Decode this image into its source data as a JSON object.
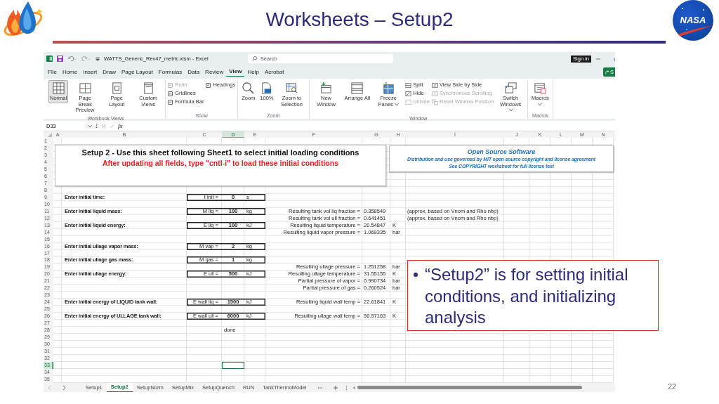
{
  "slide": {
    "title": "Worksheets – Setup2",
    "logo_text": "NASA",
    "page_number": "22",
    "callout": {
      "text": "“Setup2” is for setting initial conditions, and initializing analysis"
    }
  },
  "excel": {
    "title_bar": {
      "file_title": "WATTS_Generic_Rev47_metric.xlsm  -  Excel",
      "search": {
        "placeholder": "Search"
      },
      "sign_in": "Sign in",
      "share": "S"
    },
    "menu": [
      {
        "label": "File",
        "selected": false
      },
      {
        "label": "Home",
        "selected": false
      },
      {
        "label": "Insert",
        "selected": false
      },
      {
        "label": "Draw",
        "selected": false
      },
      {
        "label": "Page Layout",
        "selected": false
      },
      {
        "label": "Formulas",
        "selected": false
      },
      {
        "label": "Data",
        "selected": false
      },
      {
        "label": "Review",
        "selected": false
      },
      {
        "label": "View",
        "selected": true
      },
      {
        "label": "Help",
        "selected": false
      },
      {
        "label": "Acrobat",
        "selected": false
      }
    ],
    "ribbon": [
      {
        "label": "Workbook Views",
        "columns": [
          [
            {
              "kind": "large",
              "label": "Normal",
              "selected": true
            }
          ],
          [
            {
              "kind": "large",
              "label": "Page Break Preview",
              "selected": false
            }
          ],
          [
            {
              "kind": "large",
              "label": "Page Layout",
              "selected": false
            }
          ],
          [
            {
              "kind": "large",
              "label": "Custom Views",
              "selected": false
            }
          ]
        ]
      },
      {
        "label": "Show",
        "columns": [
          [
            {
              "kind": "check",
              "label": "Ruler",
              "checked": true,
              "disabled": true
            },
            {
              "kind": "check",
              "label": "Gridlines",
              "checked": true,
              "disabled": false
            },
            {
              "kind": "check",
              "label": "Formula Bar",
              "checked": true,
              "disabled": false
            }
          ],
          [
            {
              "kind": "check",
              "label": "Headings",
              "checked": true,
              "disabled": false
            }
          ]
        ]
      },
      {
        "label": "Zoom",
        "columns": [
          [
            {
              "kind": "large",
              "label": "Zoom"
            }
          ],
          [
            {
              "kind": "large",
              "label": "100%"
            }
          ],
          [
            {
              "kind": "large",
              "label": "Zoom to Selection"
            }
          ]
        ]
      },
      {
        "label": "Window",
        "columns": [
          [
            {
              "kind": "large",
              "label": "New Window"
            }
          ],
          [
            {
              "kind": "large",
              "label": "Arrange All"
            }
          ],
          [
            {
              "kind": "large",
              "label": "Freeze Panes",
              "dropdown": true
            }
          ],
          [
            {
              "kind": "small",
              "label": "Split",
              "disabled": false
            },
            {
              "kind": "small",
              "label": "Hide",
              "disabled": false
            },
            {
              "kind": "small",
              "label": "Unhide",
              "disabled": true
            }
          ],
          [
            {
              "kind": "small",
              "label": "View Side by Side",
              "disabled": false
            },
            {
              "kind": "small",
              "label": "Synchronous Scrolling",
              "disabled": true
            },
            {
              "kind": "small",
              "label": "Reset Window Position",
              "disabled": true
            }
          ],
          [
            {
              "kind": "large",
              "label": "Switch Windows",
              "dropdown": true
            }
          ]
        ]
      },
      {
        "label": "Macros",
        "columns": [
          [
            {
              "kind": "large",
              "label": "Macros",
              "dropdown": true
            }
          ]
        ]
      }
    ],
    "formula_bar": {
      "name_box": "D33",
      "fx": "fx"
    },
    "sheet": {
      "columns": [
        "A",
        "B",
        "C",
        "D",
        "E",
        "F",
        "G",
        "H",
        "I",
        "J",
        "K",
        "L",
        "M",
        "N"
      ],
      "text_boxes": [
        {
          "lines": [
            {
              "kind": "heading",
              "text": "Setup 2 - Use this sheet following Sheet1 to select initial loading conditions"
            },
            {
              "kind": "warning",
              "text": "After updating all fields, type \"cntl-i\" to load these initial conditions"
            }
          ]
        },
        {
          "lines": [
            {
              "kind": "os-title",
              "text": "Open Source Software"
            },
            {
              "kind": "os-note",
              "text": "Distribution and use governed by MIT open source copyright and license agreement"
            },
            {
              "kind": "os-note",
              "text": "See COPYRIGHT worksheet for full license text"
            }
          ]
        }
      ],
      "rows": [
        {
          "number": "1"
        },
        {
          "number": "2"
        },
        {
          "number": "3"
        },
        {
          "number": "4"
        },
        {
          "number": "5"
        },
        {
          "number": "6"
        },
        {
          "number": "7"
        },
        {
          "number": "8"
        },
        {
          "number": "9",
          "boxed": true,
          "cells": {
            "B": {
              "kind": "label",
              "text": "Enter initial time:"
            },
            "C": {
              "kind": "name",
              "text": "t init ="
            },
            "D": {
              "kind": "value",
              "text": "0"
            },
            "E": {
              "kind": "unit",
              "text": "s"
            }
          }
        },
        {
          "number": "10"
        },
        {
          "number": "11",
          "boxed": true,
          "cells": {
            "B": {
              "kind": "label",
              "text": "Enter initial liquid mass:"
            },
            "C": {
              "kind": "name",
              "text": "M liq ="
            },
            "D": {
              "kind": "value",
              "text": "100"
            },
            "E": {
              "kind": "unit",
              "text": "kg"
            },
            "F": {
              "kind": "result-label",
              "text": "Resulting tank vol liq fraction ="
            },
            "G": {
              "kind": "result",
              "text": "0.358549"
            },
            "I": {
              "kind": "note",
              "text": "(approx, based on Vnom and Rho nbp)"
            }
          }
        },
        {
          "number": "12",
          "cells": {
            "F": {
              "kind": "result-label",
              "text": "Resulting tank vol ull fraction ="
            },
            "G": {
              "kind": "result",
              "text": "0.641451"
            },
            "I": {
              "kind": "note",
              "text": "(approx, based on Vnom and Rho nbp)"
            }
          }
        },
        {
          "number": "13",
          "boxed": true,
          "cells": {
            "B": {
              "kind": "label",
              "text": "Enter initial liquid energy:"
            },
            "C": {
              "kind": "name",
              "text": "E liq ="
            },
            "D": {
              "kind": "value",
              "text": "100"
            },
            "E": {
              "kind": "unit",
              "text": "kJ"
            },
            "F": {
              "kind": "result-label",
              "text": "Resulting liquid temperature ="
            },
            "G": {
              "kind": "result",
              "text": "20.54847"
            },
            "H": {
              "kind": "unit",
              "text": "K"
            }
          }
        },
        {
          "number": "14",
          "cells": {
            "F": {
              "kind": "result-label",
              "text": "Resulting liquid vapor pressure ="
            },
            "G": {
              "kind": "result",
              "text": "1.069335"
            },
            "H": {
              "kind": "unit",
              "text": "bar"
            }
          }
        },
        {
          "number": "15"
        },
        {
          "number": "16",
          "boxed": true,
          "cells": {
            "B": {
              "kind": "label",
              "text": "Enter initial ullage vapor mass:"
            },
            "C": {
              "kind": "name",
              "text": "M vap ="
            },
            "D": {
              "kind": "value",
              "text": "2"
            },
            "E": {
              "kind": "unit",
              "text": "kg"
            }
          }
        },
        {
          "number": "17"
        },
        {
          "number": "18",
          "boxed": true,
          "cells": {
            "B": {
              "kind": "label",
              "text": "Enter initial ullage gas mass:"
            },
            "C": {
              "kind": "name",
              "text": "M gas ="
            },
            "D": {
              "kind": "value",
              "text": "1"
            },
            "E": {
              "kind": "unit",
              "text": "kg"
            }
          }
        },
        {
          "number": "19",
          "cells": {
            "F": {
              "kind": "result-label",
              "text": "Resulting ullage pressure ="
            },
            "G": {
              "kind": "result",
              "text": "1.251258"
            },
            "H": {
              "kind": "unit",
              "text": "bar"
            }
          }
        },
        {
          "number": "20",
          "boxed": true,
          "cells": {
            "B": {
              "kind": "label",
              "text": "Enter initial ullage energy:"
            },
            "C": {
              "kind": "name",
              "text": "E ull ="
            },
            "D": {
              "kind": "value",
              "text": "500"
            },
            "E": {
              "kind": "unit",
              "text": "kJ"
            },
            "F": {
              "kind": "result-label",
              "text": "Resulting ullage temperature ="
            },
            "G": {
              "kind": "result",
              "text": "31.55155"
            },
            "H": {
              "kind": "unit",
              "text": "K"
            }
          }
        },
        {
          "number": "21",
          "cells": {
            "F": {
              "kind": "result-label",
              "text": "Partial pressure of vapor ="
            },
            "G": {
              "kind": "result",
              "text": "0.990734"
            },
            "H": {
              "kind": "unit",
              "text": "bar"
            }
          }
        },
        {
          "number": "22",
          "cells": {
            "F": {
              "kind": "result-label",
              "text": "Partial pressure of gas ="
            },
            "G": {
              "kind": "result",
              "text": "0.260524"
            },
            "H": {
              "kind": "unit",
              "text": "bar"
            }
          }
        },
        {
          "number": "23"
        },
        {
          "number": "24",
          "boxed": true,
          "cells": {
            "B": {
              "kind": "label",
              "text": "Enter initial energy of LIQUID tank wall:"
            },
            "C": {
              "kind": "name",
              "text": "E wall liq ="
            },
            "D": {
              "kind": "value",
              "text": "1500"
            },
            "E": {
              "kind": "unit",
              "text": "kJ"
            },
            "F": {
              "kind": "result-label",
              "text": "Resulting liquid wall temp ="
            },
            "G": {
              "kind": "result",
              "text": "22.61841"
            },
            "H": {
              "kind": "unit",
              "text": "K"
            }
          }
        },
        {
          "number": "25"
        },
        {
          "number": "26",
          "boxed": true,
          "cells": {
            "B": {
              "kind": "label",
              "text": "Enter initial energy of ULLAGE tank wall:"
            },
            "C": {
              "kind": "name",
              "text": "E wall ull ="
            },
            "D": {
              "kind": "value",
              "text": "6000"
            },
            "E": {
              "kind": "unit",
              "text": "kJ"
            },
            "F": {
              "kind": "result-label",
              "text": "Resulting ullage wall temp ="
            },
            "G": {
              "kind": "result",
              "text": "50.57163"
            },
            "H": {
              "kind": "unit",
              "text": "K"
            }
          }
        },
        {
          "number": "27"
        },
        {
          "number": "28",
          "cells": {
            "D": {
              "kind": "unit",
              "text": "done"
            }
          }
        },
        {
          "number": "29"
        },
        {
          "number": "30"
        },
        {
          "number": "31"
        },
        {
          "number": "32"
        },
        {
          "number": "33",
          "cells": {
            "D": {
              "kind": "empty",
              "selected": true
            }
          }
        },
        {
          "number": "34"
        },
        {
          "number": "35"
        }
      ]
    },
    "sheet_tabs": [
      {
        "label": "Setup1",
        "selected": false
      },
      {
        "label": "Setup2",
        "selected": true
      },
      {
        "label": "SetupNorm",
        "selected": false
      },
      {
        "label": "SetupMix",
        "selected": false
      },
      {
        "label": "SetupQuench",
        "selected": false
      },
      {
        "label": "RUN",
        "selected": false
      },
      {
        "label": "TankThermoModel",
        "selected": false
      }
    ]
  }
}
